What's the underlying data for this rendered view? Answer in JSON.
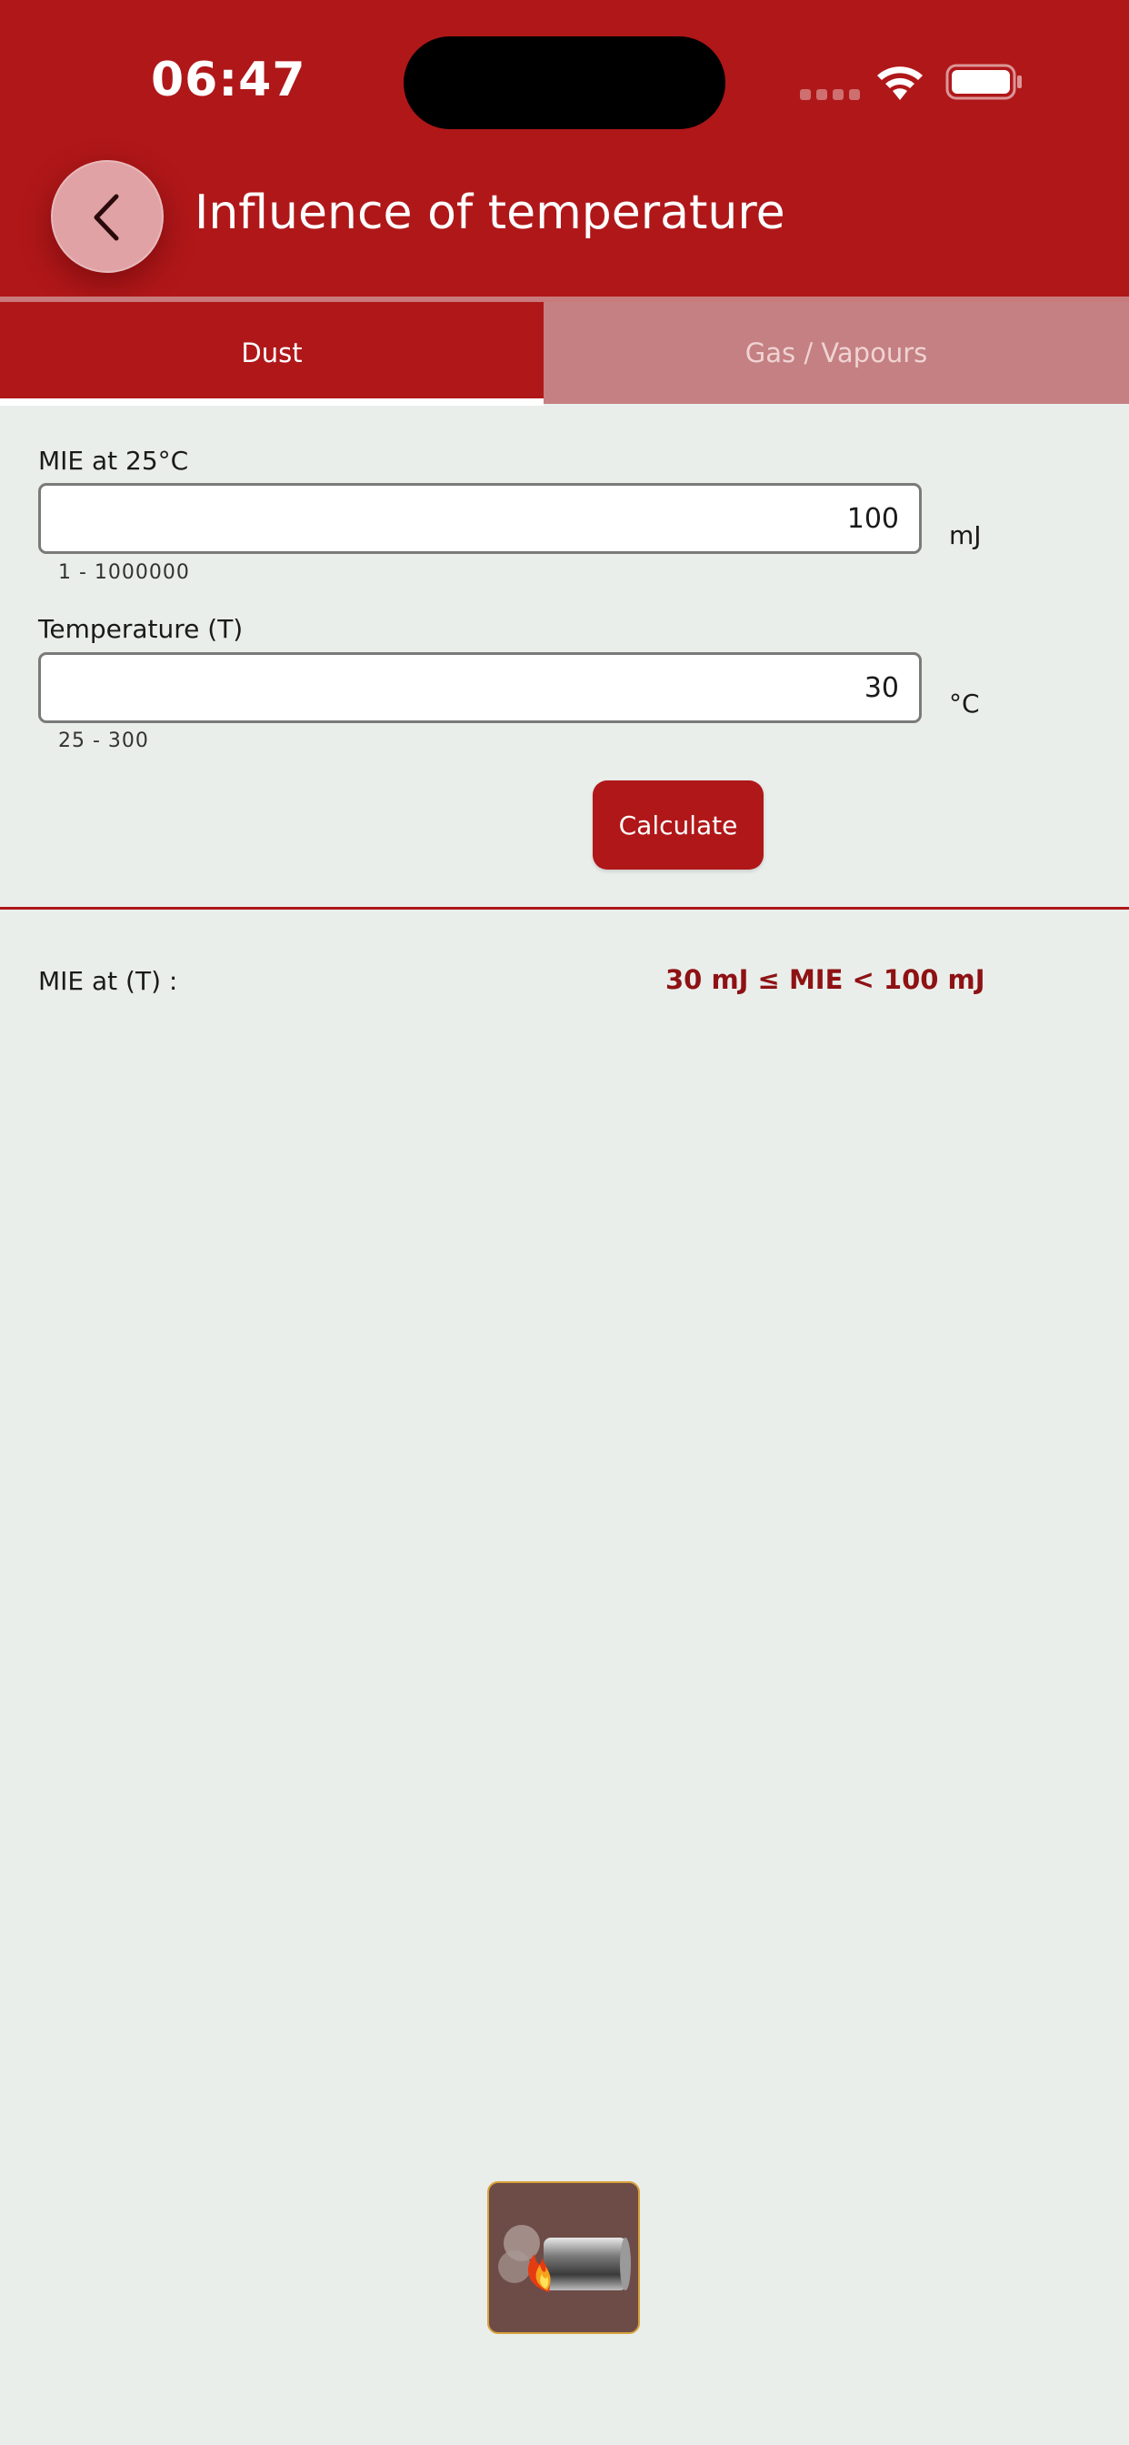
{
  "status_bar": {
    "time": "06:47",
    "icons": [
      "signal-icon",
      "wifi-icon",
      "battery-icon"
    ]
  },
  "header": {
    "title": "Influence of temperature",
    "back_icon": "chevron-left-icon"
  },
  "tabs": [
    {
      "label": "Dust",
      "active": true
    },
    {
      "label": "Gas / Vapours",
      "active": false
    }
  ],
  "form": {
    "mie": {
      "label": "MIE at 25°C",
      "value": "100",
      "unit": "mJ",
      "range": "1 - 1000000"
    },
    "temperature": {
      "label": "Temperature (T)",
      "value": "30",
      "unit": "°C",
      "range": "25 - 300"
    },
    "calculate_label": "Calculate"
  },
  "result": {
    "label": "MIE at (T) :",
    "value": "30 mJ ≤ MIE < 100 mJ"
  },
  "colors": {
    "brand": "#b01719",
    "tab_inactive": "#c48082",
    "background": "#eaeeeb",
    "result_text": "#8e1214"
  }
}
